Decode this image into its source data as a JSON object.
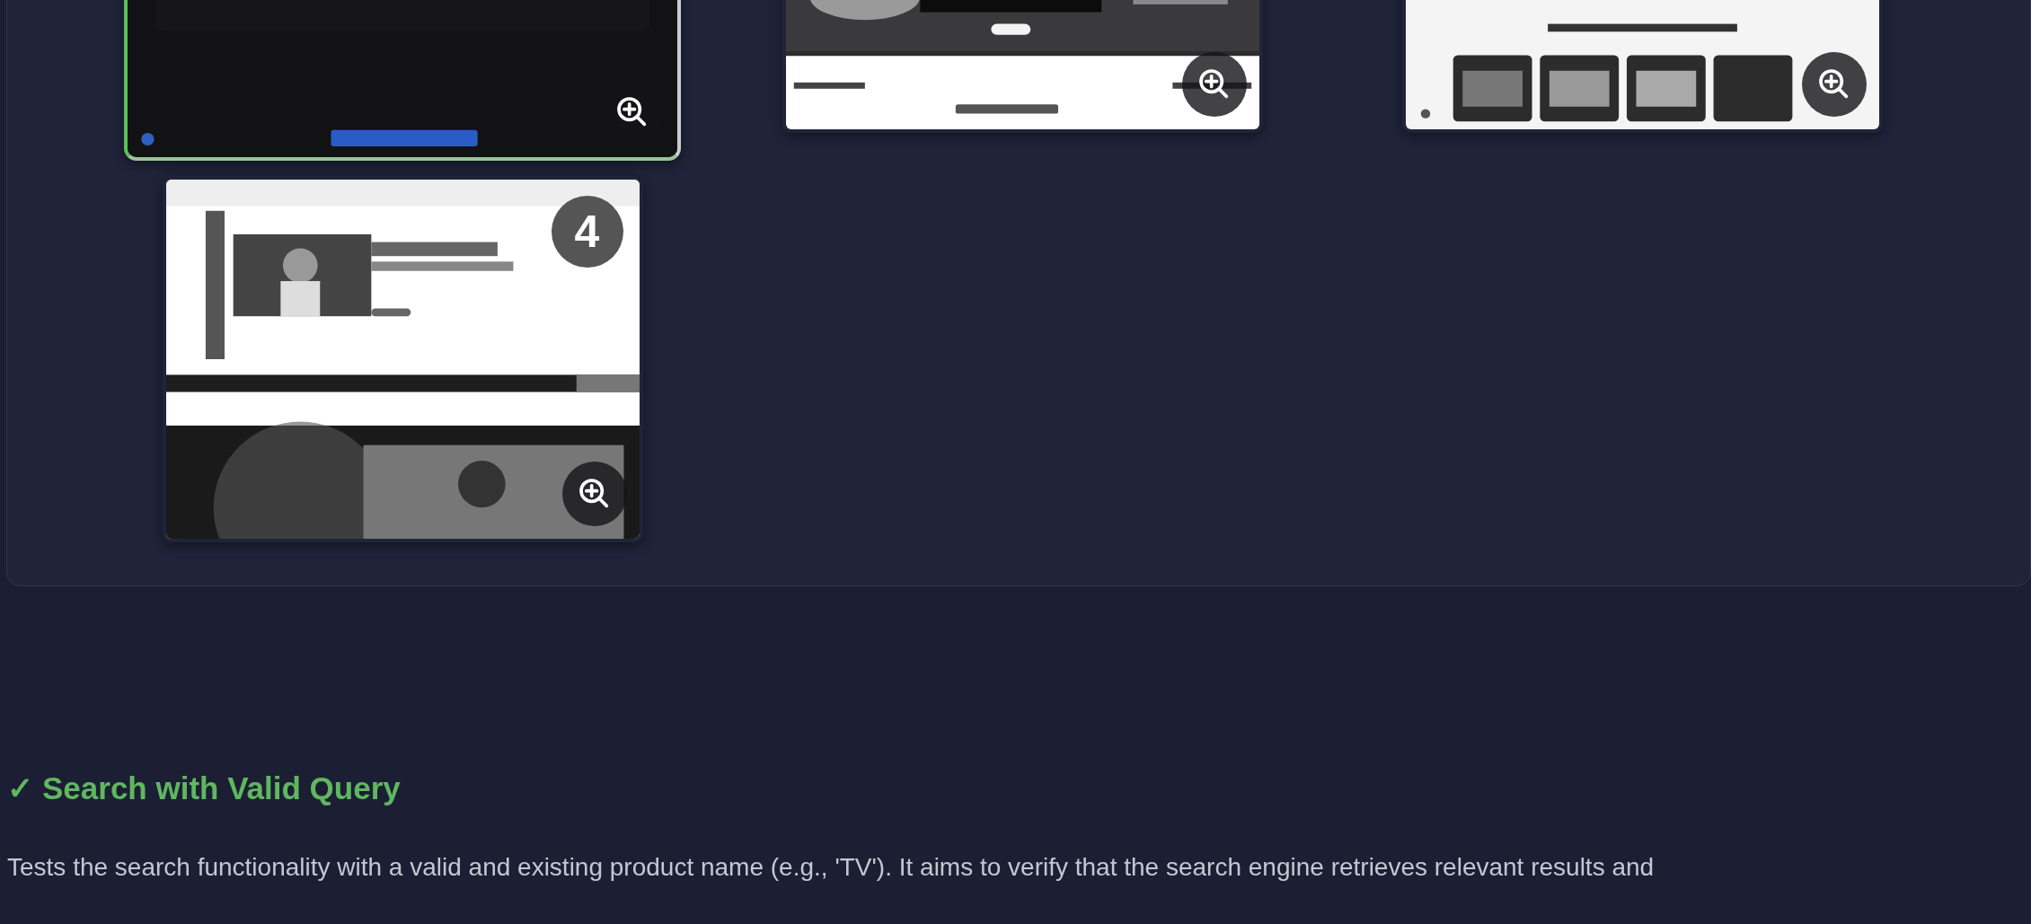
{
  "screenshots": [
    {
      "highlighted": true
    },
    {
      "highlighted": false
    },
    {
      "highlighted": false
    },
    {
      "highlighted": false,
      "badge": "4"
    }
  ],
  "test": {
    "passed": true,
    "icon": "✓",
    "title": "Search with Valid Query",
    "description": "Tests the search functionality with a valid and existing product name (e.g., 'TV'). It aims to verify that the search engine retrieves relevant results and"
  }
}
